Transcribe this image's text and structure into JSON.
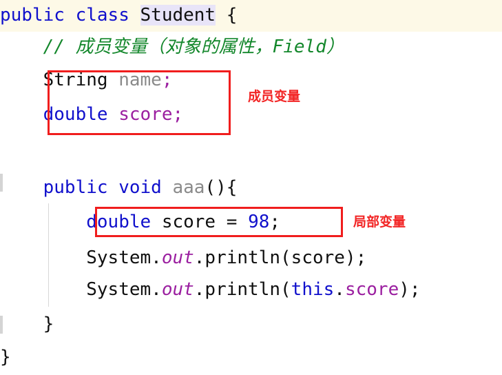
{
  "editor": {
    "language": "java",
    "colors": {
      "keyword": "#1010cc",
      "plain": "#101010",
      "declared_identifier": "#8a8a8a",
      "field_reference": "#9b1fa0",
      "comment": "#13872b",
      "number": "#1010cc",
      "annotation_red": "#f22424",
      "current_line_background": "#fdf9e7",
      "occurrence_highlight": "#e8e4f8",
      "indent_guide": "#d8d8d8",
      "background": "#ffffff"
    }
  },
  "code": {
    "line1": {
      "kw_public": "public",
      "space1": " ",
      "kw_class": "class",
      "space2": " ",
      "type_student": "Student",
      "brace": " {"
    },
    "line2": {
      "indent": "    ",
      "comment": "// 成员变量（对象的属性，Field）"
    },
    "line3": {
      "indent": "    ",
      "type_string": "String",
      "space": " ",
      "ident_name": "name",
      "semicolon": ";"
    },
    "line4": {
      "indent": "    ",
      "kw_double": "double",
      "space": " ",
      "field_score": "score",
      "semicolon": ";"
    },
    "line5": {
      "indent": "    ",
      "kw_public": "public",
      "space1": " ",
      "kw_void": "void",
      "space2": " ",
      "ident_aaa": "aaa",
      "parens": "(){"
    },
    "line6": {
      "indent": "        ",
      "kw_double": "double",
      "space1": " ",
      "var_score": "score",
      "equals": " = ",
      "num_98": "98",
      "semicolon": ";"
    },
    "line7": {
      "indent": "        ",
      "system": "System.",
      "out": "out",
      "println_open": ".println(",
      "arg_score": "score",
      "close": ");"
    },
    "line8": {
      "indent": "        ",
      "system": "System.",
      "out": "out",
      "println_open": ".println(",
      "kw_this": "this",
      "dot": ".",
      "field_score": "score",
      "close": ");"
    },
    "line9": {
      "indent": "    ",
      "brace": "}"
    },
    "line10": {
      "brace": "}"
    }
  },
  "annotations": {
    "member_variable_label": "成员变量",
    "local_variable_label": "局部变量"
  }
}
